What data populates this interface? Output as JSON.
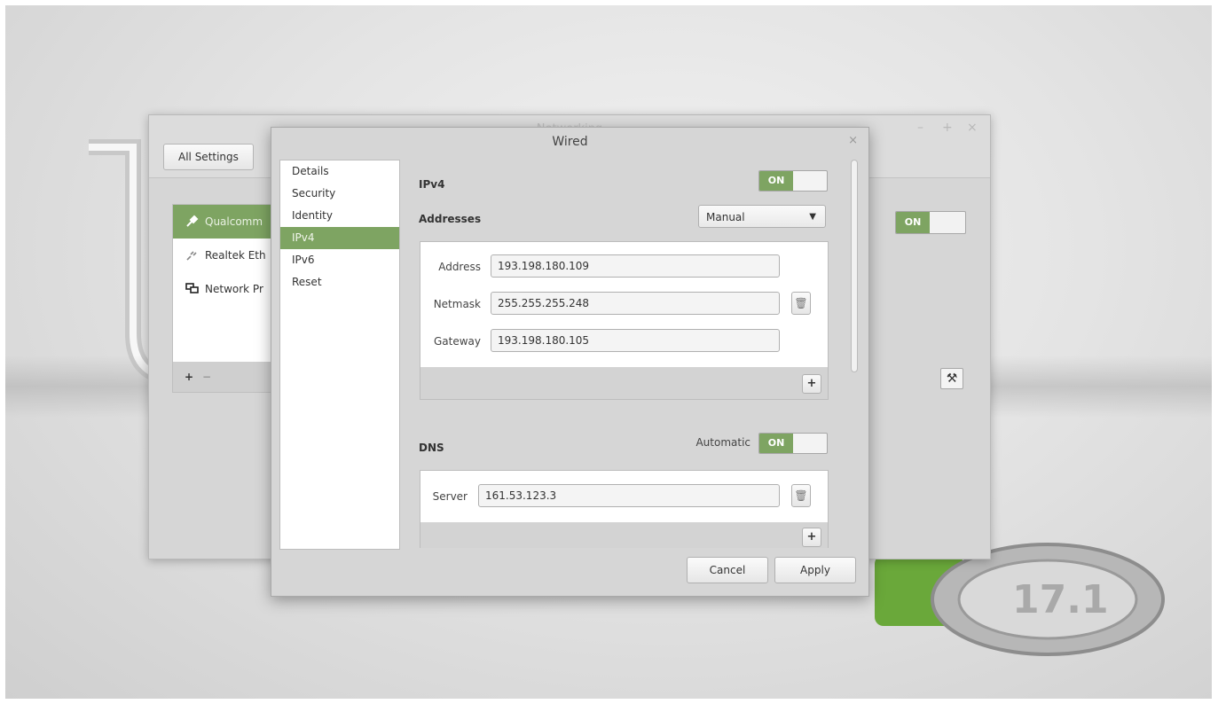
{
  "networking_window": {
    "title": "Networking",
    "controls": {
      "minimize": "–",
      "maximize": "+",
      "close": "×"
    },
    "all_settings_label": "All Settings",
    "devices": [
      {
        "label": "Qualcomm",
        "icon": "wireless-plug-icon",
        "selected": true
      },
      {
        "label": "Realtek Eth",
        "icon": "ethernet-plug-icon",
        "selected": false
      },
      {
        "label": "Network Pr",
        "icon": "network-proxy-icon",
        "selected": false
      }
    ],
    "add_label": "+",
    "remove_label": "−",
    "toggle_on_label": "ON"
  },
  "wired_dialog": {
    "title": "Wired",
    "close_label": "×",
    "sidebar": [
      "Details",
      "Security",
      "Identity",
      "IPv4",
      "IPv6",
      "Reset"
    ],
    "selected_sidebar_item": "IPv4",
    "ipv4": {
      "label": "IPv4",
      "toggle_label": "ON",
      "addresses_label": "Addresses",
      "method": "Manual",
      "address_label": "Address",
      "address_value": "193.198.180.109",
      "netmask_label": "Netmask",
      "netmask_value": "255.255.255.248",
      "gateway_label": "Gateway",
      "gateway_value": "193.198.180.105",
      "add_label": "+"
    },
    "dns": {
      "label": "DNS",
      "automatic_label": "Automatic",
      "toggle_label": "ON",
      "server_label": "Server",
      "server_value": "161.53.123.3",
      "add_label": "+"
    },
    "cancel_label": "Cancel",
    "apply_label": "Apply"
  },
  "colors": {
    "accent": "#7ea462",
    "background": "#d6d6d6"
  }
}
